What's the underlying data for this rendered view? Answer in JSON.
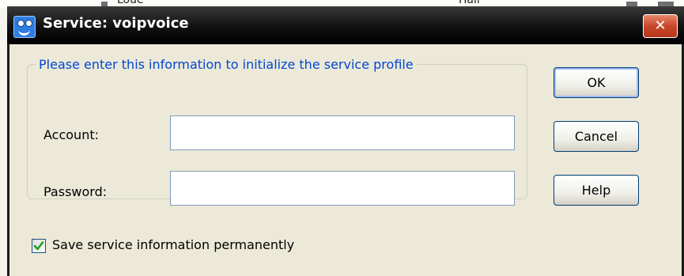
{
  "background": {
    "partial_text_left": "Loue",
    "partial_text_right": "ITali"
  },
  "window": {
    "title": "Service: voipvoice",
    "close_glyph": "✕"
  },
  "group": {
    "legend": "Please enter this information to initialize the service profile",
    "account_label": "Account:",
    "account_value": "",
    "password_label": "Password:",
    "password_value": ""
  },
  "buttons": {
    "ok": "OK",
    "cancel": "Cancel",
    "help": "Help"
  },
  "save_option": {
    "label": "Save service information permanently",
    "checked": true
  },
  "colors": {
    "legend_text": "#0046d5",
    "close_button": "#c7472a",
    "titlebar": "#000000"
  }
}
